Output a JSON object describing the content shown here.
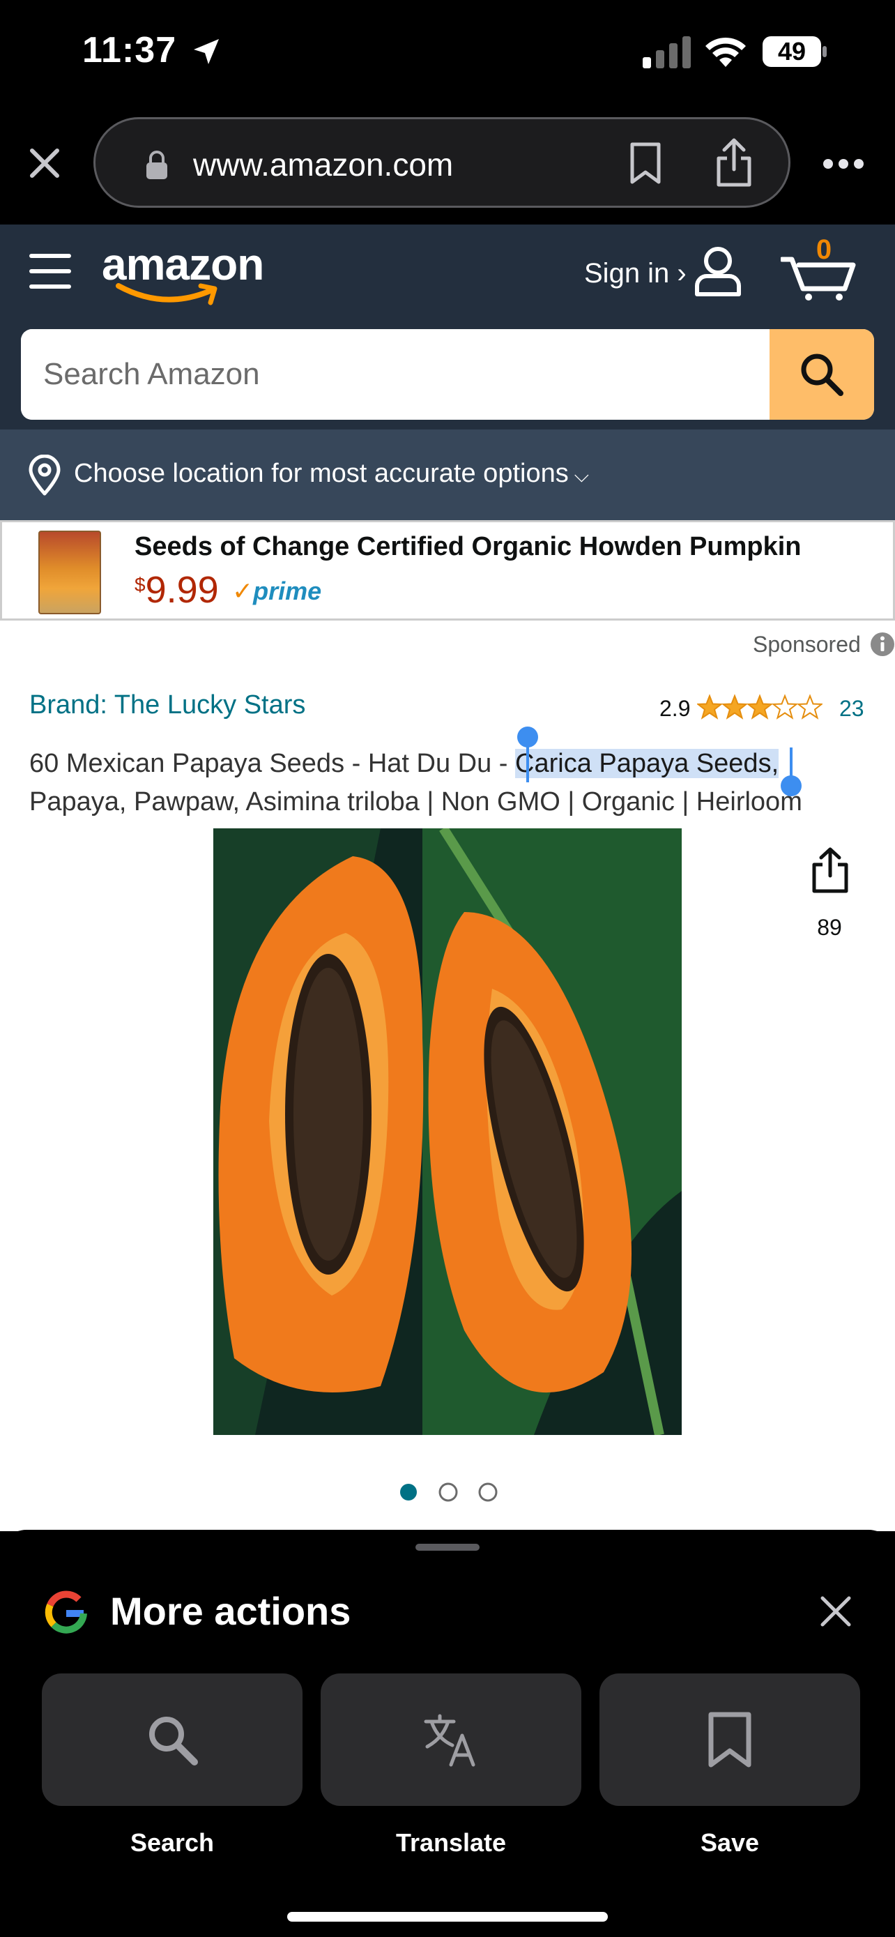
{
  "status_bar": {
    "time": "11:37",
    "battery": "49"
  },
  "browser": {
    "url": "www.amazon.com"
  },
  "header": {
    "logo": "amazon",
    "sign_in": "Sign in ›",
    "cart_count": "0",
    "search_placeholder": "Search Amazon"
  },
  "location": {
    "text": "Choose location for most accurate options",
    "chevron": "⌵"
  },
  "ad": {
    "title": "Seeds of Change Certified Organic Howden Pumpkin",
    "price_symbol": "$",
    "price": "9.99",
    "prime_check": "✓",
    "prime_label": "prime",
    "sponsored": "Sponsored"
  },
  "product": {
    "brand": "Brand: The Lucky Stars",
    "rating": "2.9",
    "stars": 2.9,
    "review_count": "23",
    "title_before": "60 Mexican Papaya Seeds - Hat Du Du - ",
    "title_selected": "Carica Papaya Seeds,",
    "title_after": " Papaya, Pawpaw, Asimina triloba | Non GMO | Organic | Heirloom",
    "share_count": "89",
    "image_count": 3,
    "image_index": 1
  },
  "sheet": {
    "title": "More actions",
    "actions": [
      {
        "label": "Search",
        "icon": "search-icon"
      },
      {
        "label": "Translate",
        "icon": "translate-icon"
      },
      {
        "label": "Save",
        "icon": "bookmark-icon"
      }
    ]
  },
  "colors": {
    "amazon_header": "#232F3E",
    "location_bar": "#37475A",
    "search_button": "#FEBD69",
    "link": "#007185",
    "price": "#B12704",
    "selection": "#cfe0f6"
  }
}
